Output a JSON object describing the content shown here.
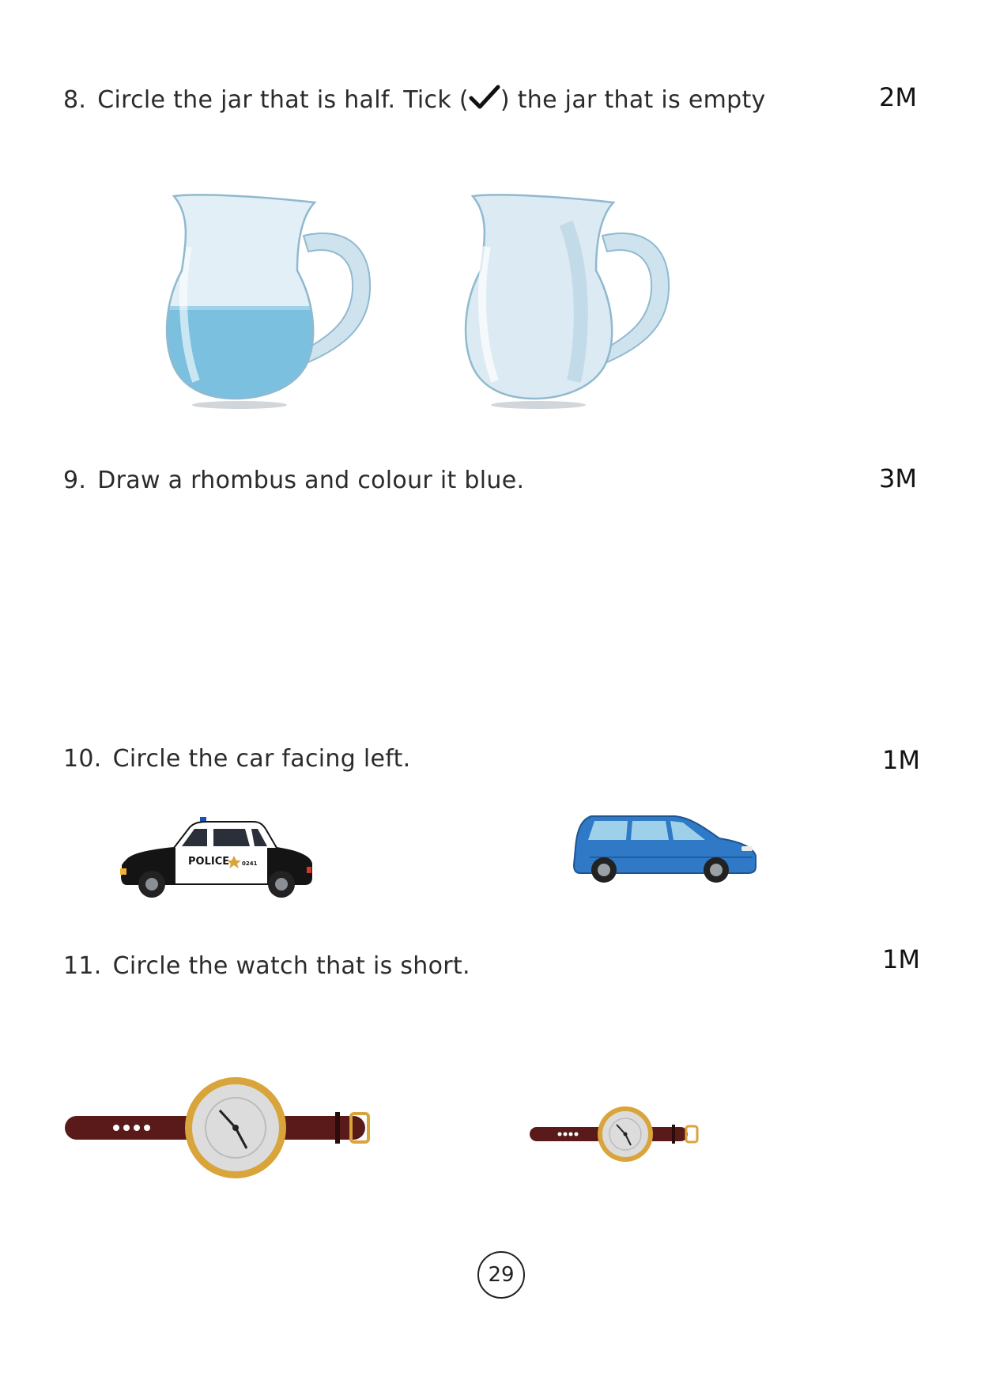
{
  "questions": [
    {
      "number": "8.",
      "text_before_tick": "Circle the jar that is half. Tick (",
      "text_after_tick": ") the jar that is empty",
      "marks": "2M",
      "images": [
        "half-filled-jug",
        "empty-jug"
      ]
    },
    {
      "number": "9.",
      "text": "Draw a rhombus and colour it blue.",
      "marks": "3M"
    },
    {
      "number": "10.",
      "text": "Circle the car facing left.",
      "marks": "1M",
      "images": [
        "police-car",
        "blue-car"
      ],
      "police_label": "POLICE",
      "police_number": "0241"
    },
    {
      "number": "11.",
      "text": "Circle the watch that is short.",
      "marks": "1M",
      "images": [
        "long-watch",
        "short-watch"
      ]
    }
  ],
  "page_number": "29",
  "colors": {
    "water": "#7cc0e0",
    "glass": "#dcebf3",
    "police_black": "#141414",
    "car_blue": "#2f79c6",
    "watch_strap": "#5a1a1a",
    "watch_gold": "#d9a43a"
  }
}
